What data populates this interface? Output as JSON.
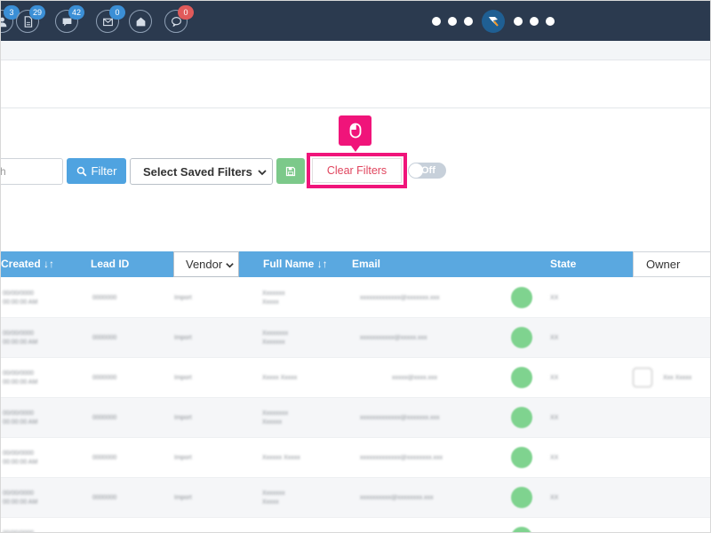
{
  "topbar": {
    "badges": [
      {
        "icon": "person-icon",
        "count": "3"
      },
      {
        "icon": "document-icon",
        "count": "29"
      },
      {
        "icon": "chat-icon",
        "count": "42"
      },
      {
        "icon": "mail-icon",
        "count": "0"
      },
      {
        "icon": "open-mail-icon",
        "count": ""
      },
      {
        "icon": "speech-bubble-icon",
        "count": "0"
      }
    ],
    "logo_icon": "app-logo-icon"
  },
  "filters": {
    "search_placeholder": "h",
    "filter_label": "Filter",
    "saved_filters_label": "Select Saved Filters",
    "clear_filters_label": "Clear Filters",
    "toggle_label": "Off"
  },
  "tooltip": {
    "icon": "mouse-icon"
  },
  "colors": {
    "accent": "#5aa8e0",
    "highlight": "#f0147a",
    "clear_text": "#e0455e",
    "save_btn": "#7cc98a"
  },
  "table": {
    "headers": {
      "created": "Created ↓↑",
      "lead_id": "Lead ID",
      "vendor": "Vendor",
      "full_name": "Full Name ↓↑",
      "email": "Email",
      "state": "State",
      "owner": "Owner"
    },
    "rows": [
      {
        "created": [
          "00/00/0000",
          "00:00:00 AM"
        ],
        "lead_id": "0000000",
        "vendor": "Import",
        "name": [
          "Xxxxxxx",
          "Xxxxx"
        ],
        "email": "xxxxxxxxxxxxx@xxxxxxx.xxx",
        "state": "XX",
        "owner": ""
      },
      {
        "created": [
          "00/00/0000",
          "00:00:00 AM"
        ],
        "lead_id": "0000000",
        "vendor": "Import",
        "name": [
          "Xxxxxxxx",
          "Xxxxxxx"
        ],
        "email": "xxxxxxxxxxx@xxxxx.xxx",
        "state": "XX",
        "owner": ""
      },
      {
        "created": [
          "00/00/0000",
          "00:00:00 AM"
        ],
        "lead_id": "0000000",
        "vendor": "Import",
        "name": [
          "Xxxxx Xxxxx"
        ],
        "email": "xxxxx@xxxx.xxx",
        "state": "XX",
        "owner": "Xxx Xxxxx"
      },
      {
        "created": [
          "00/00/0000",
          "00:00:00 AM"
        ],
        "lead_id": "0000000",
        "vendor": "Import",
        "name": [
          "Xxxxxxxx",
          "Xxxxxx"
        ],
        "email": "xxxxxxxxxxxxx@xxxxxxx.xxx",
        "state": "XX",
        "owner": ""
      },
      {
        "created": [
          "00/00/0000",
          "00:00:00 AM"
        ],
        "lead_id": "0000000",
        "vendor": "Import",
        "name": [
          "Xxxxxx Xxxxx"
        ],
        "email": "xxxxxxxxxxxxx@xxxxxxxx.xxx",
        "state": "XX",
        "owner": ""
      },
      {
        "created": [
          "00/00/0000",
          "00:00:00 AM"
        ],
        "lead_id": "0000000",
        "vendor": "Import",
        "name": [
          "Xxxxxxx",
          "Xxxxx"
        ],
        "email": "xxxxxxxxxx@xxxxxxxx.xxx",
        "state": "XX",
        "owner": ""
      },
      {
        "created": [
          "00/00/0000",
          "00:00:00 AM"
        ],
        "lead_id": "0000000",
        "vendor": "Import",
        "name": [
          "Xxxxxx"
        ],
        "email": "xxxxxxxxxx@xxxxx.xxx",
        "state": "XX",
        "owner": ""
      }
    ]
  }
}
